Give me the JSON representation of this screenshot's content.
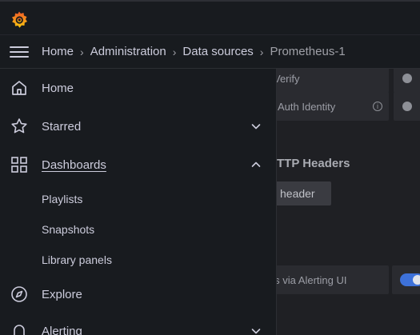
{
  "breadcrumb": {
    "items": [
      "Home",
      "Administration",
      "Data sources"
    ],
    "current": "Prometheus-1",
    "separator": "›"
  },
  "background": {
    "row1_label": "Verify",
    "row2_label": "Auth Identity",
    "info_symbol": "i",
    "heading": "TTP Headers",
    "button_label": "header",
    "alert_label": "erts via Alerting UI"
  },
  "menu": {
    "home": "Home",
    "starred": "Starred",
    "dashboards": "Dashboards",
    "playlists": "Playlists",
    "snapshots": "Snapshots",
    "library_panels": "Library panels",
    "explore": "Explore",
    "alerting": "Alerting"
  },
  "colors": {
    "brand_orange": "#f46800",
    "toggle_blue": "#3d71d9",
    "background": "#111217",
    "panel": "#181b1f"
  }
}
